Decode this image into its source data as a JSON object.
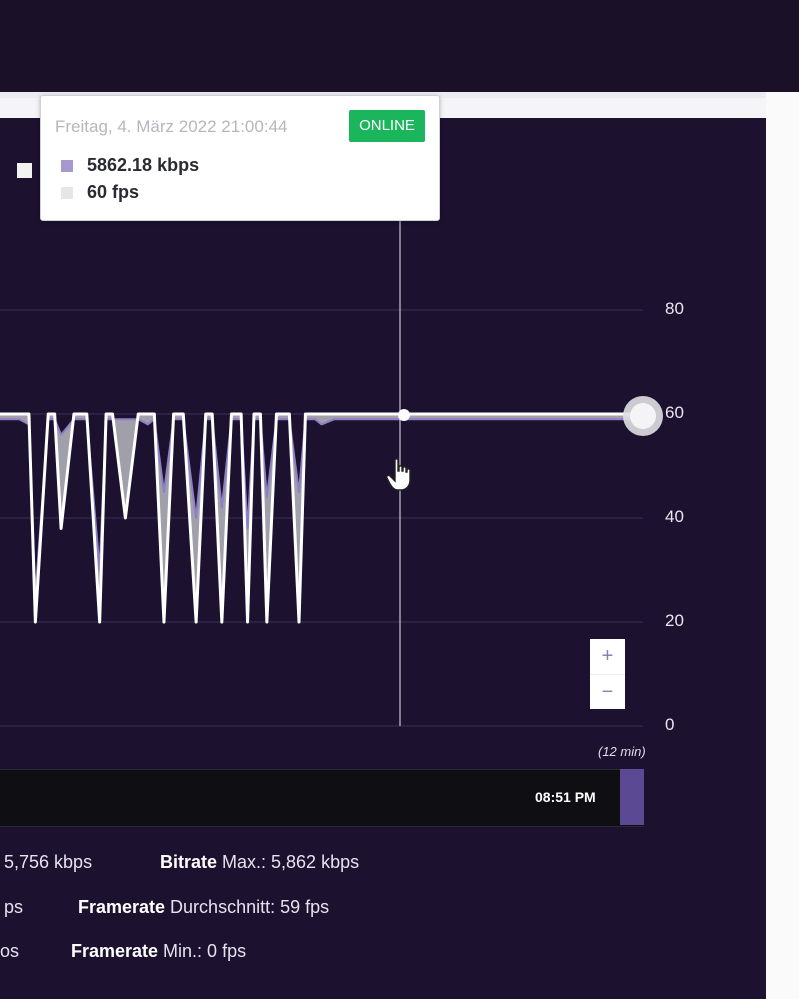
{
  "tooltip": {
    "date": "Freitag, 4. März 2022 21:00:44",
    "status": "ONLINE",
    "status_color": "#1bb55c",
    "bitrate": "5862.18 kbps",
    "framerate": "60 fps",
    "bitrate_color": "#a898d0",
    "framerate_color": "#e6e6e6"
  },
  "y_ticks": [
    "80",
    "60",
    "40",
    "20",
    "0"
  ],
  "range_label": "(12 min)",
  "navigator_time": "08:51 PM",
  "zoom": {
    "plus": "+",
    "minus": "−"
  },
  "stats": [
    {
      "label": "",
      "value": "5,756 kbps"
    },
    {
      "label": "Bitrate",
      "value": " Max.: 5,862 kbps"
    },
    {
      "label": "",
      "value": "ps"
    },
    {
      "label": "Framerate",
      "value": " Durchschnitt: 59 fps"
    },
    {
      "label": "",
      "value": "os"
    },
    {
      "label": "Framerate",
      "value": " Min.: 0 fps"
    }
  ],
  "colors": {
    "background": "#1c1230",
    "topbar": "#1a1128",
    "bitrate_line": "#8f7fc4",
    "framerate_line": "#ffffff",
    "area_fill": "#b8b8c0"
  },
  "chart_data": {
    "type": "line",
    "xlabel": "",
    "ylabel": "",
    "ylim": [
      0,
      90
    ],
    "x_unit": "min",
    "x": [
      0,
      0.3,
      0.45,
      0.55,
      0.75,
      0.85,
      0.95,
      1.15,
      1.3,
      1.35,
      1.55,
      1.65,
      1.75,
      1.95,
      2.15,
      2.3,
      2.4,
      2.55,
      2.7,
      2.85,
      3.05,
      3.2,
      3.3,
      3.45,
      3.6,
      3.75,
      3.85,
      3.95,
      4.05,
      4.15,
      4.3,
      4.4,
      4.5,
      4.65,
      4.75,
      4.9,
      5.0,
      5.2,
      5.5,
      6.0,
      8.0,
      10.0
    ],
    "series": [
      {
        "name": "",
        "values": [
          60,
          60,
          60,
          20,
          60,
          60,
          38,
          60,
          60,
          60,
          20,
          60,
          60,
          40,
          60,
          60,
          60,
          20,
          60,
          60,
          20,
          60,
          60,
          20,
          60,
          60,
          20,
          60,
          60,
          20,
          60,
          60,
          60,
          20,
          60,
          60,
          60,
          60,
          60,
          60,
          60,
          60
        ]
      },
      {
        "name": "",
        "values": [
          59,
          59,
          58,
          25,
          59,
          59,
          56,
          59,
          59,
          59,
          30,
          59,
          59,
          59,
          59,
          58,
          59,
          45,
          59,
          59,
          40,
          59,
          59,
          42,
          59,
          59,
          38,
          59,
          59,
          44,
          59,
          59,
          59,
          45,
          59,
          59,
          58,
          59,
          59,
          59,
          59,
          59
        ]
      }
    ]
  }
}
